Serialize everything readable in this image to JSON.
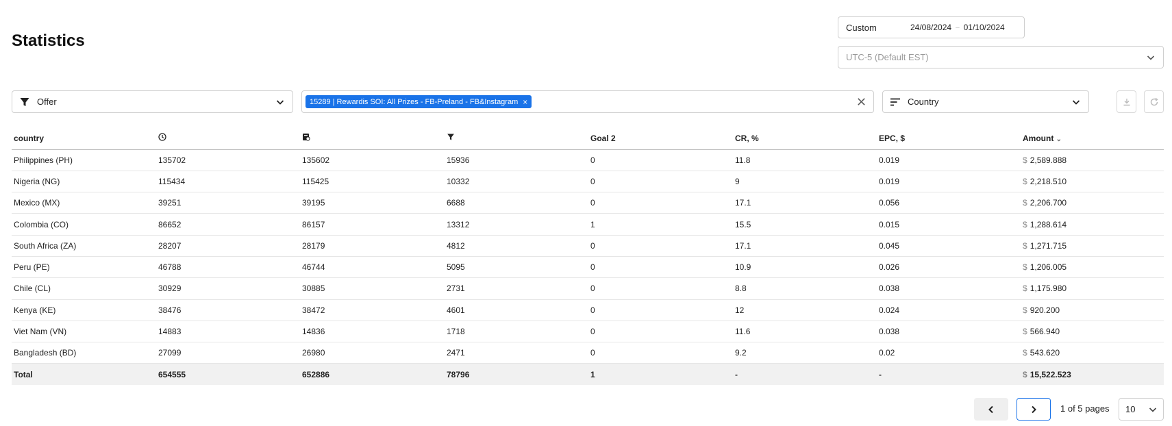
{
  "page": {
    "title": "Statistics"
  },
  "date_range": {
    "preset": "Custom",
    "from": "24/08/2024",
    "separator": "–",
    "to": "01/10/2024"
  },
  "timezone": {
    "placeholder": "UTC-5 (Default EST)"
  },
  "filter": {
    "label": "Offer"
  },
  "selected_offer": {
    "tag": "15289 | Rewardis SOI: All Prizes - FB-Preland - FB&Instagram",
    "remove": "×"
  },
  "group_by": {
    "label": "Country"
  },
  "table": {
    "headers": {
      "country": "country",
      "goal2": "Goal 2",
      "cr": "CR, %",
      "epc": "EPC, $",
      "amount": "Amount",
      "sort_indicator": "⌄"
    },
    "currency": "$",
    "rows": [
      {
        "country": "Philippines (PH)",
        "c1": "135702",
        "c2": "135602",
        "c3": "15936",
        "goal2": "0",
        "cr": "11.8",
        "epc": "0.019",
        "amount": "2,589.888"
      },
      {
        "country": "Nigeria (NG)",
        "c1": "115434",
        "c2": "115425",
        "c3": "10332",
        "goal2": "0",
        "cr": "9",
        "epc": "0.019",
        "amount": "2,218.510"
      },
      {
        "country": "Mexico (MX)",
        "c1": "39251",
        "c2": "39195",
        "c3": "6688",
        "goal2": "0",
        "cr": "17.1",
        "epc": "0.056",
        "amount": "2,206.700"
      },
      {
        "country": "Colombia (CO)",
        "c1": "86652",
        "c2": "86157",
        "c3": "13312",
        "goal2": "1",
        "cr": "15.5",
        "epc": "0.015",
        "amount": "1,288.614"
      },
      {
        "country": "South Africa (ZA)",
        "c1": "28207",
        "c2": "28179",
        "c3": "4812",
        "goal2": "0",
        "cr": "17.1",
        "epc": "0.045",
        "amount": "1,271.715"
      },
      {
        "country": "Peru (PE)",
        "c1": "46788",
        "c2": "46744",
        "c3": "5095",
        "goal2": "0",
        "cr": "10.9",
        "epc": "0.026",
        "amount": "1,206.005"
      },
      {
        "country": "Chile (CL)",
        "c1": "30929",
        "c2": "30885",
        "c3": "2731",
        "goal2": "0",
        "cr": "8.8",
        "epc": "0.038",
        "amount": "1,175.980"
      },
      {
        "country": "Kenya (KE)",
        "c1": "38476",
        "c2": "38472",
        "c3": "4601",
        "goal2": "0",
        "cr": "12",
        "epc": "0.024",
        "amount": "920.200"
      },
      {
        "country": "Viet Nam (VN)",
        "c1": "14883",
        "c2": "14836",
        "c3": "1718",
        "goal2": "0",
        "cr": "11.6",
        "epc": "0.038",
        "amount": "566.940"
      },
      {
        "country": "Bangladesh (BD)",
        "c1": "27099",
        "c2": "26980",
        "c3": "2471",
        "goal2": "0",
        "cr": "9.2",
        "epc": "0.02",
        "amount": "543.620"
      }
    ],
    "total": {
      "label": "Total",
      "c1": "654555",
      "c2": "652886",
      "c3": "78796",
      "goal2": "1",
      "cr": "-",
      "epc": "-",
      "amount": "15,522.523"
    }
  },
  "pagination": {
    "info": "1 of 5 pages",
    "page_size": "10"
  },
  "colors": {
    "accent": "#1a73e8",
    "total_row": "#f1f1f1",
    "border": "#cfcfcf"
  }
}
